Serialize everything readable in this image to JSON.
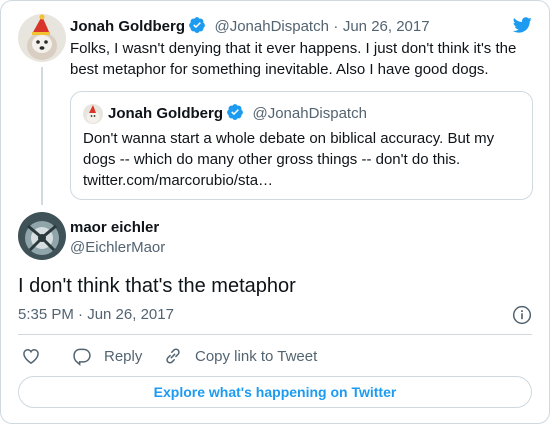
{
  "original_tweet": {
    "author_name": "Jonah Goldberg",
    "author_handle": "@JonahDispatch",
    "separator": "·",
    "date": "Jun 26, 2017",
    "text": "Folks, I wasn't denying that it ever happens. I just don't think it's the best metaphor for something inevitable. Also I have good dogs."
  },
  "quoted_tweet": {
    "author_name": "Jonah Goldberg",
    "author_handle": "@JonahDispatch",
    "text": "Don't wanna start a whole debate on biblical accuracy. But my dogs -- which do many other gross things -- don't do this. twitter.com/marcorubio/sta…"
  },
  "reply_tweet": {
    "author_name": "maor eichler",
    "author_handle": "@EichlerMaor",
    "text": "I don't think that's the metaphor",
    "timestamp": "5:35 PM · Jun 26, 2017"
  },
  "actions": {
    "reply_label": "Reply",
    "copy_link_label": "Copy link to Tweet"
  },
  "explore_button_label": "Explore what's happening on Twitter",
  "colors": {
    "twitter_blue": "#1d9bf0",
    "text": "#0f1419",
    "muted": "#536471",
    "border": "#cfd9de"
  },
  "icons": [
    "twitter-bird-icon",
    "verified-badge-icon",
    "info-icon",
    "heart-icon",
    "reply-icon",
    "link-icon"
  ]
}
